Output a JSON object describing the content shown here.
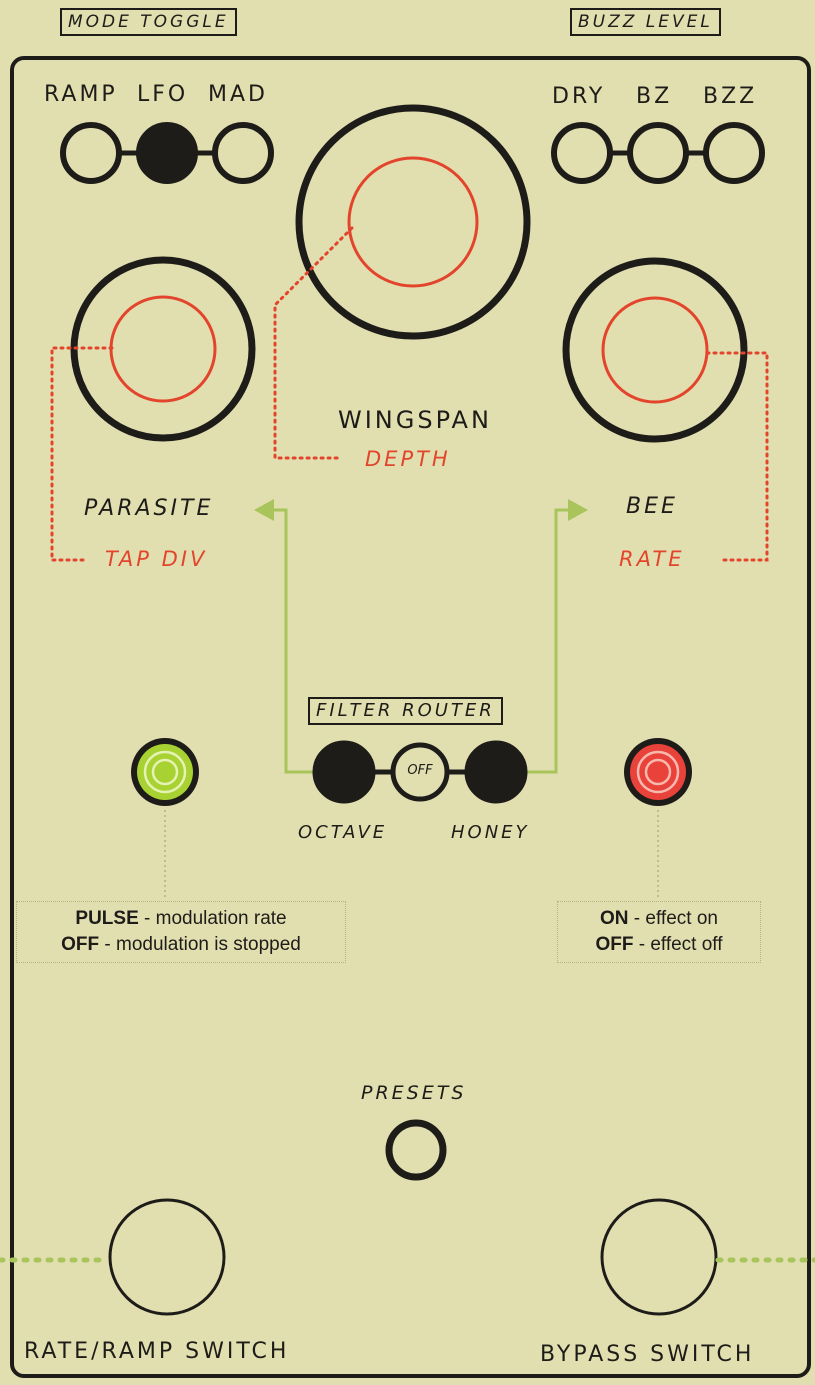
{
  "labels": {
    "mode_toggle": "MODE TOGGLE",
    "buzz_level": "BUZZ LEVEL",
    "mode_options": [
      "RAMP",
      "LFO",
      "MAD"
    ],
    "buzz_options": [
      "DRY",
      "BZ",
      "BZZ"
    ],
    "wingspan": "WINGSPAN",
    "depth": "DEPTH",
    "parasite": "PARASITE",
    "tap_div": "TAP DIV",
    "bee": "BEE",
    "rate": "RATE",
    "filter_router": "FILTER ROUTER",
    "off": "OFF",
    "octave": "OCTAVE",
    "honey": "HONEY",
    "presets": "PRESETS",
    "rate_ramp_switch": "RATE/RAMP SWITCH",
    "bypass_switch": "BYPASS SWITCH"
  },
  "notes": {
    "left": {
      "line1_key": "PULSE",
      "line1_text": " - modulation rate",
      "line2_key": "OFF",
      "line2_text": " - modulation is stopped"
    },
    "right": {
      "line1_key": "ON",
      "line1_text": " - effect on",
      "line2_key": "OFF",
      "line2_text": " - effect off"
    }
  },
  "state": {
    "mode_selected": "LFO",
    "buzz_selected": "none",
    "filter_router_filled": [
      "OCTAVE",
      "HONEY"
    ]
  },
  "colors": {
    "background": "#e1dfb0",
    "ink": "#1e1c18",
    "knob_inner": "#e3452c",
    "route_arrow": "#a8c45a",
    "led_green": "#a8d232",
    "led_red": "#e8423a"
  }
}
